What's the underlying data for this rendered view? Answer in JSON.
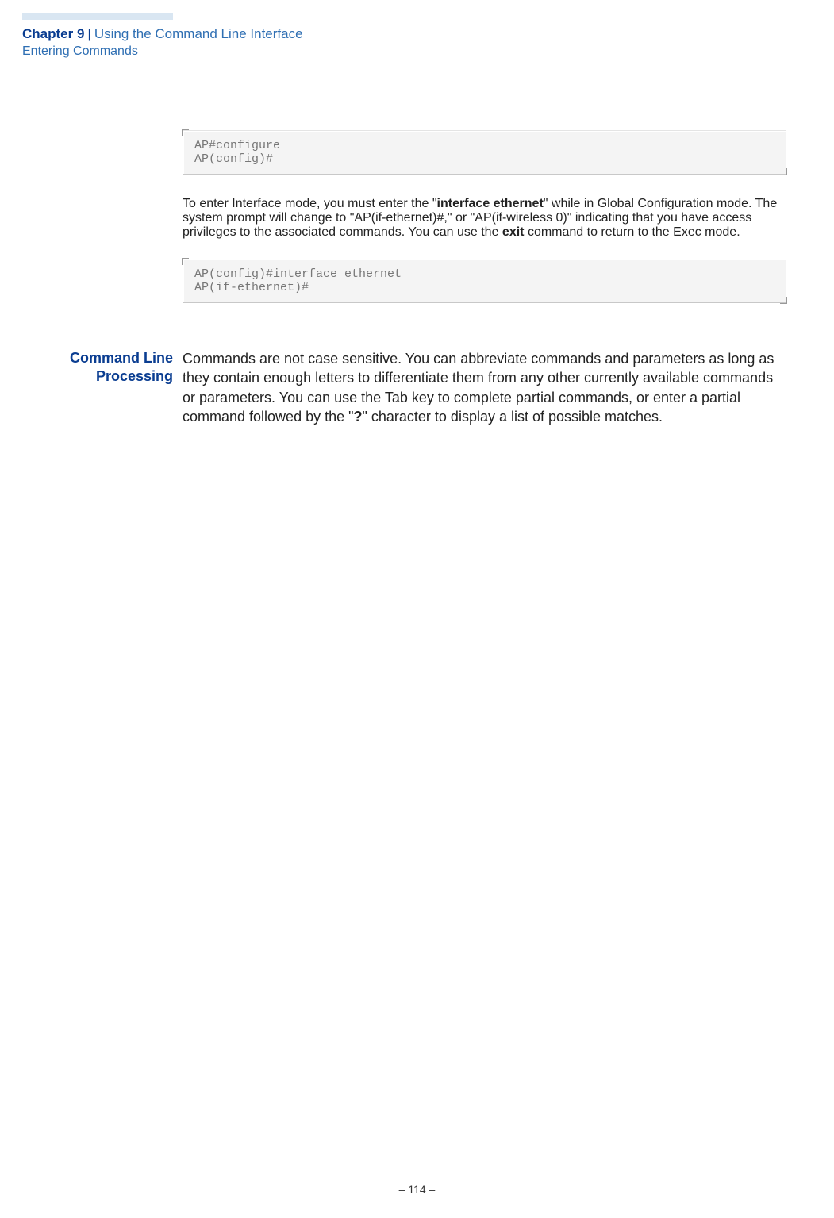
{
  "header": {
    "chapter_label": "Chapter 9",
    "chapter_title": "Using the Command Line Interface",
    "section": "Entering Commands"
  },
  "code1": "AP#configure\nAP(config)#",
  "para1": {
    "t1": "To enter Interface mode, you must enter the \"",
    "b1": "interface ethernet",
    "t2": "\" while in Global Configuration mode. The system prompt will change to  \"AP(if-ethernet)#,\" or \"AP(if-wireless 0)\" indicating that you have access privileges to the associated commands. You can use the ",
    "b2": "exit",
    "t3": " command to return to the Exec mode."
  },
  "code2": "AP(config)#interface ethernet\nAP(if-ethernet)#",
  "section2": {
    "heading_l1": "Command Line",
    "heading_l2": "Processing",
    "t1": "Commands are not case sensitive. You can abbreviate commands and parameters as long as they contain enough letters to differentiate them from any other currently available commands or parameters. You can use the Tab key to complete partial commands, or enter a partial command followed by the \"",
    "b1": "?",
    "t2": "\" character to display a list of possible matches."
  },
  "footer": "–  114  –"
}
